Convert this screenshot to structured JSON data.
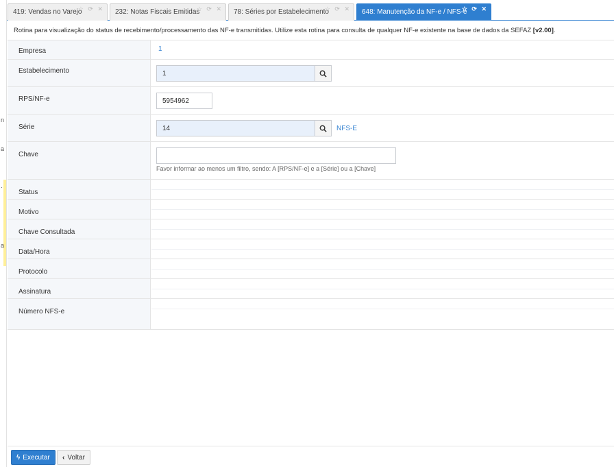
{
  "tabs": [
    {
      "label": "419: Vendas no Varejo",
      "icons": "☆ ⟳ ✕"
    },
    {
      "label": "232: Notas Fiscais Emitidas",
      "icons": "☆ ⟳ ✕"
    },
    {
      "label": "78: Séries por Estabelecimento",
      "icons": "☆ ⟳ ✕"
    },
    {
      "label": "648: Manutenção da NF-e / NFS-e",
      "icons": "☆ ⟳ ✕"
    }
  ],
  "description": {
    "text": "Rotina para visualização do status de recebimento/processamento das NF-e transmitidas. Utilize esta rotina para consulta de qualquer NF-e existente na base de dados da SEFAZ",
    "version": "[v2.00]"
  },
  "form": {
    "empresa": {
      "label": "Empresa",
      "value": "1"
    },
    "estabelecimento": {
      "label": "Estabelecimento",
      "value": "1"
    },
    "rps": {
      "label": "RPS/NF-e",
      "value": "5954962"
    },
    "serie": {
      "label": "Série",
      "value": "14",
      "description": "NFS-E"
    },
    "chave": {
      "label": "Chave",
      "value": "",
      "hint": "Favor informar ao menos um filtro, sendo: A [RPS/NF-e] e a [Série] ou a [Chave]"
    },
    "status": {
      "label": "Status"
    },
    "motivo": {
      "label": "Motivo"
    },
    "chave_consultada": {
      "label": "Chave Consultada"
    },
    "data_hora": {
      "label": "Data/Hora"
    },
    "protocolo": {
      "label": "Protocolo"
    },
    "assinatura": {
      "label": "Assinatura"
    },
    "numero_nfse": {
      "label": "Número NFS-e"
    }
  },
  "footer": {
    "execute_label": "Executar",
    "back_label": "Voltar"
  },
  "left_fragments": [
    "n",
    "a",
    "·",
    "a"
  ],
  "colors": {
    "accent": "#2f7fd0",
    "lookup_bg": "#e8f0fb"
  }
}
